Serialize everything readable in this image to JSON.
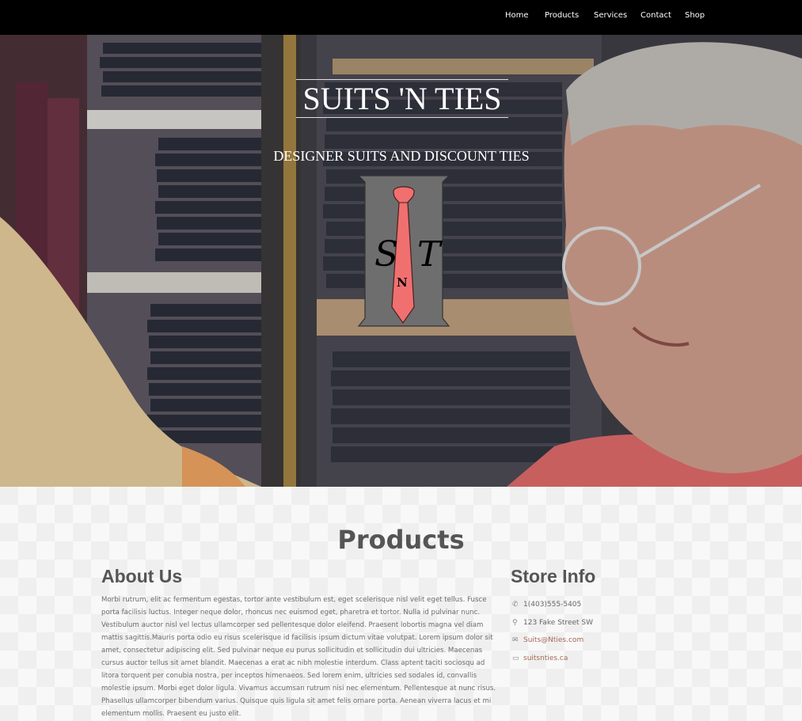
{
  "nav": {
    "items": [
      "Home",
      "Products",
      "Services",
      "Contact",
      "Shop"
    ]
  },
  "hero": {
    "title": "SUITS 'N TIES",
    "subtitle": "DESIGNER SUITS AND DISCOUNT TIES",
    "logo_letters": [
      "S",
      "T",
      "N"
    ]
  },
  "main": {
    "section_title": "Products",
    "about": {
      "heading": "About Us",
      "text": "Morbi rutrum, elit ac fermentum egestas, tortor ante vestibulum est, eget scelerisque nisl velit eget tellus. Fusce porta facilisis luctus. Integer neque dolor, rhoncus nec euismod eget, pharetra et tortor. Nulla id pulvinar nunc. Vestibulum auctor nisl vel lectus ullamcorper sed pellentesque dolor eleifend. Praesent lobortis magna vel diam mattis sagittis.Mauris porta odio eu risus scelerisque id facilisis ipsum dictum vitae volutpat. Lorem ipsum dolor sit amet, consectetur adipiscing elit. Sed pulvinar neque eu purus sollicitudin et sollicitudin dui ultricies. Maecenas cursus auctor tellus sit amet blandit. Maecenas a erat ac nibh molestie interdum. Class aptent taciti sociosqu ad litora torquent per conubia nostra, per inceptos himenaeos. Sed lorem enim, ultricies sed sodales id, convallis molestie ipsum. Morbi eget dolor ligula. Vivamus accumsan rutrum nisi nec elementum. Pellentesque at nunc risus. Phasellus ullamcorper bibendum varius. Quisque quis ligula sit amet felis ornare porta. Aenean viverra lacus et mi elementum mollis. Praesent eu justo elit."
    },
    "store": {
      "heading": "Store Info",
      "phone": "1(403)555-5405",
      "address": "123 Fake Street SW",
      "email": "Suits@Nties.com",
      "website": "suitsnties.ca",
      "icons": [
        "phone-icon",
        "map-marker-icon",
        "envelope-icon",
        "laptop-icon"
      ]
    }
  },
  "colors": {
    "navbar": "#000000",
    "link": "#a46a52",
    "tie": "#f07070"
  }
}
